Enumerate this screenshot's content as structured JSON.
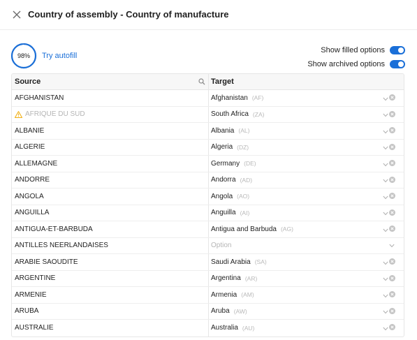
{
  "header": {
    "title": "Country of assembly - Country of manufacture"
  },
  "autofill": {
    "progress_text": "98%",
    "progress_value": 0.98,
    "link_label": "Try autofill"
  },
  "toggles": [
    {
      "label": "Show filled options",
      "on": true
    },
    {
      "label": "Show archived options",
      "on": true
    }
  ],
  "table": {
    "columns": {
      "source": "Source",
      "target": "Target"
    },
    "placeholder": "Option",
    "rows": [
      {
        "source": "AFGHANISTAN",
        "target": "Afghanistan",
        "code": "(AF)",
        "warning": false
      },
      {
        "source": "AFRIQUE DU SUD",
        "target": "South Africa",
        "code": "(ZA)",
        "warning": true
      },
      {
        "source": "ALBANIE",
        "target": "Albania",
        "code": "(AL)",
        "warning": false
      },
      {
        "source": "ALGERIE",
        "target": "Algeria",
        "code": "(DZ)",
        "warning": false
      },
      {
        "source": "ALLEMAGNE",
        "target": "Germany",
        "code": "(DE)",
        "warning": false
      },
      {
        "source": "ANDORRE",
        "target": "Andorra",
        "code": "(AD)",
        "warning": false
      },
      {
        "source": "ANGOLA",
        "target": "Angola",
        "code": "(AO)",
        "warning": false
      },
      {
        "source": "ANGUILLA",
        "target": "Anguilla",
        "code": "(AI)",
        "warning": false
      },
      {
        "source": "ANTIGUA-ET-BARBUDA",
        "target": "Antigua and Barbuda",
        "code": "(AG)",
        "warning": false
      },
      {
        "source": "ANTILLES NEERLANDAISES",
        "target": "",
        "code": "",
        "warning": false
      },
      {
        "source": "ARABIE SAOUDITE",
        "target": "Saudi Arabia",
        "code": "(SA)",
        "warning": false
      },
      {
        "source": "ARGENTINE",
        "target": "Argentina",
        "code": "(AR)",
        "warning": false
      },
      {
        "source": "ARMENIE",
        "target": "Armenia",
        "code": "(AM)",
        "warning": false
      },
      {
        "source": "ARUBA",
        "target": "Aruba",
        "code": "(AW)",
        "warning": false
      },
      {
        "source": "AUSTRALIE",
        "target": "Australia",
        "code": "(AU)",
        "warning": false
      }
    ]
  },
  "colors": {
    "accent": "#1a6fd8",
    "warning": "#f2b21b"
  },
  "icons": [
    "close-icon",
    "search-icon",
    "warning-icon",
    "chevron-down-icon",
    "clear-icon"
  ]
}
